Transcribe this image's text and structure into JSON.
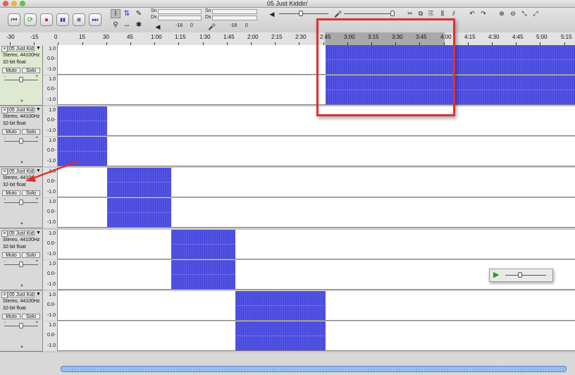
{
  "window": {
    "title": "05 Just Kiddin'",
    "traffic_colors": [
      "#ec5b55",
      "#f0b43b",
      "#5ec248"
    ]
  },
  "toolbar": {
    "transport_icons": [
      "skip-to-start-icon",
      "loop-play-icon",
      "record-icon",
      "pause-icon",
      "stop-icon",
      "skip-to-end-icon"
    ],
    "transport_glyphs": [
      "⏮",
      "⟳",
      "●",
      "▮▮",
      "■",
      "⏭"
    ],
    "tools": [
      "I",
      "⇅",
      "✎",
      "⚲",
      "↔",
      "✱"
    ],
    "meter_labels": {
      "out_top": "Sn",
      "out_bottom": "Dx",
      "in_top": "Sn",
      "in_bottom": "Dx",
      "vol_min": "-18",
      "vol_max": "0",
      "in_vol_min": "-18",
      "in_vol_max": "0"
    },
    "edit_glyphs": [
      "✂",
      "⧉",
      "⎘",
      "⫼",
      "⫽",
      "↶",
      "↷",
      "⊕",
      "⊖",
      "⤡",
      "⤢"
    ]
  },
  "ruler": {
    "labels": [
      "-30",
      "-15",
      "0",
      "15",
      "30",
      "45",
      "1:00",
      "1:15",
      "1:30",
      "1:45",
      "2:00",
      "2:15",
      "2:30",
      "2:45",
      "3:00",
      "3:15",
      "3:30",
      "3:45",
      "4:00",
      "4:15",
      "4:30",
      "4:45",
      "5:00",
      "5:15"
    ]
  },
  "tracks": [
    {
      "name": "05 Just Kid",
      "info1": "Stereo, 44100Hz",
      "info2": "32-bit float",
      "mute": "Muto",
      "solo": "Solo",
      "gain_min": "-",
      "gain_max": "+",
      "selected": true
    },
    {
      "name": "05 Just Kid",
      "info1": "Stereo, 44100Hz",
      "info2": "32-bit float",
      "mute": "Muto",
      "solo": "Solo",
      "gain_min": "-",
      "gain_max": "+",
      "selected": false
    },
    {
      "name": "05 Just Kid",
      "info1": "Stereo, 4410",
      "info2": "32-bit float",
      "mute": "Muto",
      "solo": "Solo",
      "gain_min": "-",
      "gain_max": "+",
      "selected": false
    },
    {
      "name": "05 Just Kid",
      "info1": "Stereo, 44100Hz",
      "info2": "32-bit float",
      "mute": "Muto",
      "solo": "Solo",
      "gain_min": "-",
      "gain_max": "+",
      "selected": false
    },
    {
      "name": "05 Just Kid",
      "info1": "Stereo, 44100Hz",
      "info2": "32-bit float",
      "mute": "Muto",
      "solo": "Solo",
      "gain_min": "-",
      "gain_max": "+",
      "selected": false
    }
  ],
  "vruler_labels": [
    "1.0",
    "0.0-",
    "-1.0"
  ],
  "annotation_colors": {
    "box": "#e03030",
    "arrow": "#e03030",
    "waveform": "#3c3ce0"
  }
}
